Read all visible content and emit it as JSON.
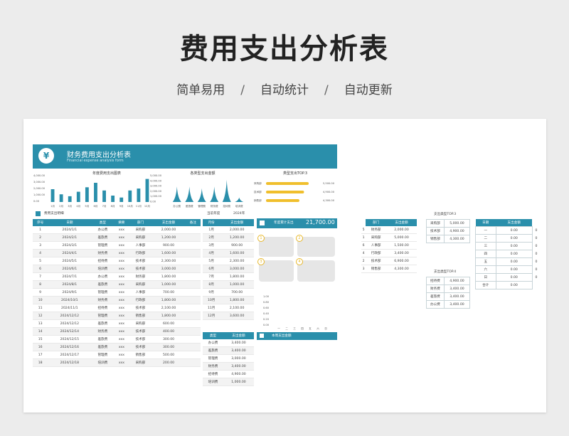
{
  "page": {
    "title": "费用支出分析表",
    "subtitle": [
      "简单易用",
      "自动统计",
      "自动更新"
    ],
    "separator": "/"
  },
  "banner": {
    "title": "财务费用支出分析表",
    "subtitle": "Financial expense analysis form",
    "icon": "money-bag-icon"
  },
  "colors": {
    "accent": "#2a8fab",
    "highlight": "#f0bf2d"
  },
  "chart_data": [
    {
      "type": "bar",
      "title": "年度费用支出图表",
      "categories": [
        "1月",
        "2月",
        "3月",
        "4月",
        "5月",
        "6月",
        "7月",
        "8月",
        "9月",
        "10月",
        "11月",
        "12月"
      ],
      "values": [
        2000,
        1200,
        900,
        1600,
        2300,
        3000,
        1800,
        1000,
        700,
        1800,
        2100,
        3600
      ],
      "ylim": [
        0,
        4000
      ],
      "yticks": [
        "4,000.00",
        "3,000.00",
        "2,000.00",
        "1,000.00",
        "0.00"
      ]
    },
    {
      "type": "area",
      "title": "各类型支出金额",
      "categories": [
        "办公费",
        "差旅费",
        "管理费",
        "财务费",
        "招待费",
        "培训费"
      ],
      "values": [
        3400,
        3400,
        3000,
        3400,
        4900,
        1000
      ],
      "ylim": [
        0,
        5000
      ],
      "yticks": [
        "5,000.00",
        "4,000.00",
        "3,000.00",
        "2,000.00",
        "1,000.00",
        "0.00"
      ]
    },
    {
      "type": "bar",
      "title": "类型支出TOP.3",
      "categories": [
        "采购部",
        "技术部",
        "销售部"
      ],
      "values": [
        5500,
        4900,
        4300
      ],
      "labels": [
        "5,500.00",
        "4,900.00",
        "4,300.00"
      ]
    }
  ],
  "detail": {
    "label": "费用支出明细",
    "year_label": "当前年度",
    "year": "2024年",
    "headers": [
      "序号",
      "日期",
      "类型",
      "摘要",
      "部门",
      "支出金额",
      "备注"
    ],
    "rows": [
      [
        "1",
        "2024/1/1",
        "办公费",
        "xxx",
        "采购部",
        "2,000.00",
        ""
      ],
      [
        "2",
        "2024/2/1",
        "差旅费",
        "xxx",
        "采购部",
        "1,200.00",
        ""
      ],
      [
        "3",
        "2024/3/1",
        "管理费",
        "xxx",
        "人事部",
        "900.00",
        ""
      ],
      [
        "4",
        "2024/4/1",
        "财务费",
        "xxx",
        "行政部",
        "1,600.00",
        ""
      ],
      [
        "5",
        "2024/5/1",
        "招待费",
        "xxx",
        "技术部",
        "2,300.00",
        ""
      ],
      [
        "6",
        "2024/6/1",
        "培训费",
        "xxx",
        "技术部",
        "3,000.00",
        ""
      ],
      [
        "7",
        "2024/7/1",
        "办公费",
        "xxx",
        "财务部",
        "1,800.00",
        ""
      ],
      [
        "8",
        "2024/8/1",
        "差旅费",
        "xxx",
        "采购部",
        "1,000.00",
        ""
      ],
      [
        "9",
        "2024/9/1",
        "管理费",
        "xxx",
        "人事部",
        "700.00",
        ""
      ],
      [
        "10",
        "2024/10/1",
        "财务费",
        "xxx",
        "行政部",
        "1,800.00",
        ""
      ],
      [
        "11",
        "2024/11/1",
        "招待费",
        "xxx",
        "技术部",
        "2,100.00",
        ""
      ],
      [
        "12",
        "2024/12/12",
        "管理费",
        "xxx",
        "销售部",
        "1,800.00",
        ""
      ],
      [
        "13",
        "2024/12/12",
        "差旅费",
        "xxx",
        "采购部",
        "600.00",
        ""
      ],
      [
        "14",
        "2024/12/14",
        "财务费",
        "xxx",
        "技术部",
        "400.00",
        ""
      ],
      [
        "15",
        "2024/12/15",
        "差旅费",
        "xxx",
        "技术部",
        "300.00",
        ""
      ],
      [
        "16",
        "2024/12/16",
        "差旅费",
        "xxx",
        "技术部",
        "300.00",
        ""
      ],
      [
        "17",
        "2024/12/17",
        "管理费",
        "xxx",
        "销售部",
        "500.00",
        ""
      ],
      [
        "18",
        "2024/12/18",
        "培训费",
        "xxx",
        "采购部",
        "200.00",
        ""
      ]
    ]
  },
  "monthly": {
    "headers": [
      "月份",
      "支出金额"
    ],
    "rows": [
      [
        "1月",
        "2,000.00"
      ],
      [
        "2月",
        "1,200.00"
      ],
      [
        "3月",
        "900.00"
      ],
      [
        "4月",
        "1,600.00"
      ],
      [
        "5月",
        "2,300.00"
      ],
      [
        "6月",
        "3,000.00"
      ],
      [
        "7月",
        "1,800.00"
      ],
      [
        "8月",
        "1,000.00"
      ],
      [
        "9月",
        "700.00"
      ],
      [
        "10月",
        "1,800.00"
      ],
      [
        "11月",
        "2,100.00"
      ],
      [
        "12月",
        "3,600.00"
      ]
    ]
  },
  "by_type": {
    "headers": [
      "类型",
      "支出金额"
    ],
    "rows": [
      [
        "办公费",
        "3,400.00"
      ],
      [
        "差旅费",
        "3,400.00"
      ],
      [
        "管理费",
        "3,000.00"
      ],
      [
        "财务费",
        "3,400.00"
      ],
      [
        "招待费",
        "4,900.00"
      ],
      [
        "培训费",
        "1,000.00"
      ]
    ]
  },
  "annual": {
    "label": "年度累计支出",
    "value": "21,700.00",
    "week_label": "本周支出金额",
    "badges": [
      "1",
      "2",
      "3",
      "4"
    ],
    "yticks": [
      "1.00",
      "0.80",
      "0.60",
      "0.40",
      "0.20",
      "0.00"
    ],
    "xticks": [
      "一",
      "二",
      "三",
      "四",
      "五",
      "六",
      "日"
    ]
  },
  "dept": {
    "headers": [
      "部门",
      "支出金额"
    ],
    "index": [
      "5",
      "1",
      "6",
      "4",
      "2",
      "3"
    ],
    "rows": [
      [
        "财务部",
        "2,000.00"
      ],
      [
        "采购部",
        "5,000.00"
      ],
      [
        "人事部",
        "1,500.00"
      ],
      [
        "行政部",
        "3,400.00"
      ],
      [
        "技术部",
        "6,900.00"
      ],
      [
        "销售部",
        "4,300.00"
      ]
    ]
  },
  "top3": {
    "title": "支出类型TOP.3",
    "rows": [
      [
        "采购部",
        "5,000.00"
      ],
      [
        "技术部",
        "4,900.00"
      ],
      [
        "销售部",
        "4,300.00"
      ]
    ]
  },
  "top4": {
    "title": "支出类型TOP.4",
    "rows": [
      [
        "招待费",
        "4,900.00"
      ],
      [
        "财务费",
        "3,400.00"
      ],
      [
        "差旅费",
        "3,400.00"
      ],
      [
        "办公费",
        "3,400.00"
      ]
    ]
  },
  "week": {
    "headers": [
      "日期",
      "支出金额"
    ],
    "rows": [
      [
        "一",
        "0.00",
        "0"
      ],
      [
        "二",
        "0.00",
        "0"
      ],
      [
        "三",
        "0.00",
        "0"
      ],
      [
        "四",
        "0.00",
        "0"
      ],
      [
        "五",
        "0.00",
        "0"
      ],
      [
        "六",
        "0.00",
        "0"
      ],
      [
        "日",
        "0.00",
        "0"
      ],
      [
        "合计",
        "0.00",
        ""
      ]
    ]
  }
}
